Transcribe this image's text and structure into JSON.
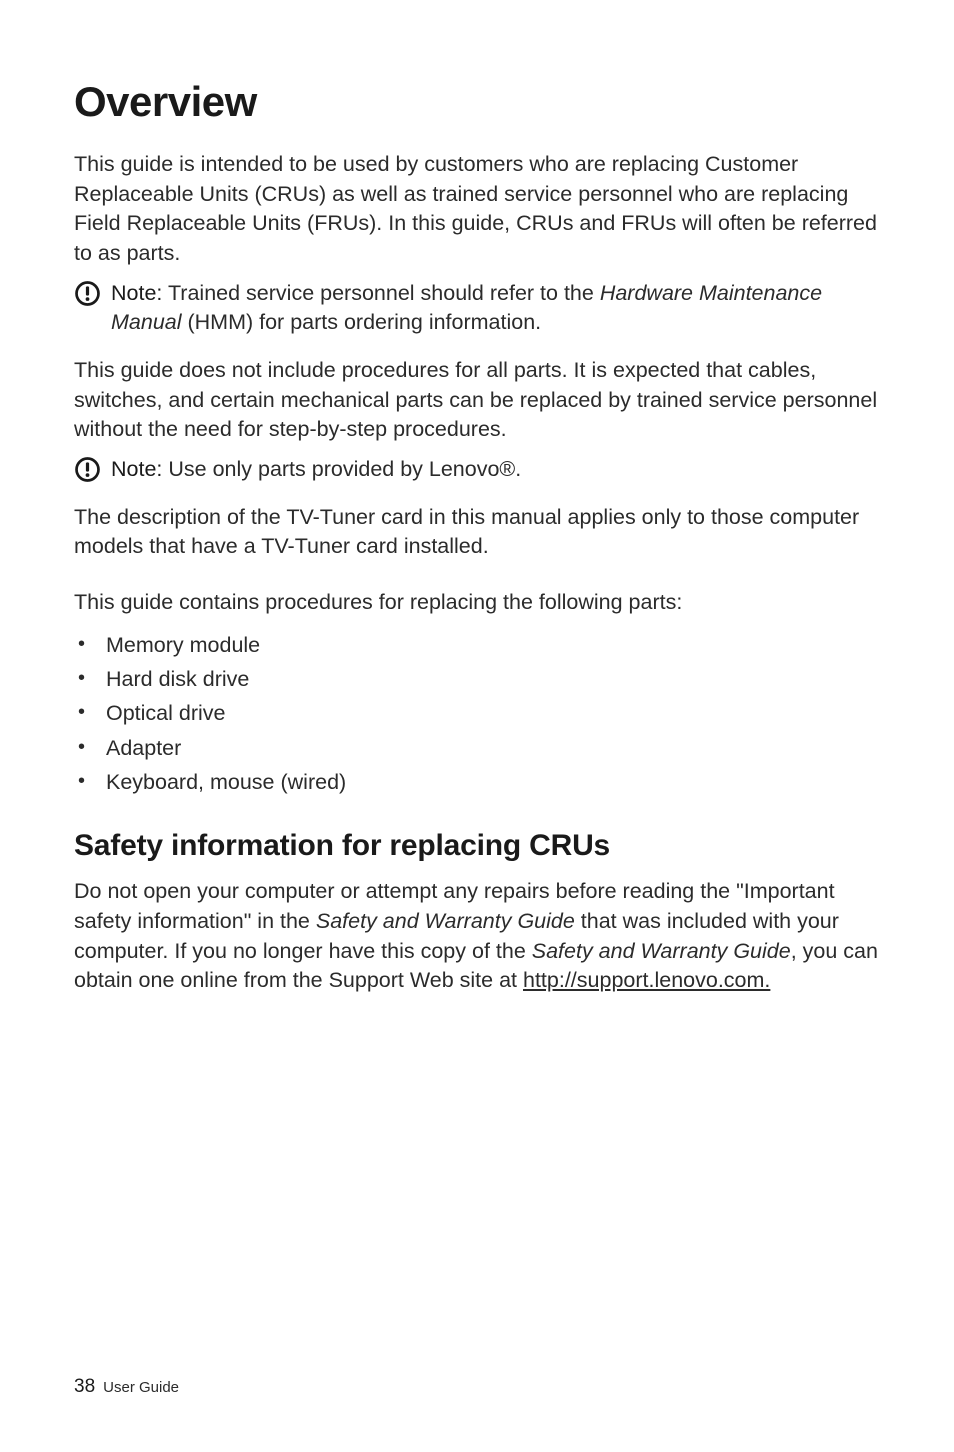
{
  "heading": "Overview",
  "intro": "This guide is intended to be used by customers who are replacing Customer Replaceable Units (CRUs) as well as trained service personnel who are replacing Field Replaceable Units (FRUs). In this guide, CRUs and FRUs will often be referred to as parts.",
  "note1": {
    "label": "Note:",
    "before_italic": " Trained service personnel should refer to the ",
    "italic": "Hardware Maintenance Manual",
    "after_italic": " (HMM) for parts ordering information."
  },
  "para2": "This guide does not include procedures for all parts. It is expected that cables, switches, and certain mechanical parts can be replaced by trained service personnel without the need for step-by-step procedures.",
  "note2": {
    "label": "Note:",
    "text": " Use only parts provided by Lenovo®."
  },
  "para3": "The description of the TV-Tuner card in this manual applies only to those computer models that have a TV-Tuner card installed.",
  "para4": "This guide contains procedures for replacing the following parts:",
  "parts": [
    "Memory module",
    "Hard disk drive",
    "Optical drive",
    "Adapter",
    "Keyboard, mouse (wired)"
  ],
  "subheading": "Safety information for replacing CRUs",
  "safety": {
    "t1": "Do not open your computer or attempt any repairs before reading the \"Important safety information\" in the ",
    "i1": "Safety and Warranty Guide",
    "t2": " that was included with your computer. If you no longer have this copy of the ",
    "i2": "Safety and Warranty Guide",
    "t3": ", you can obtain one online from the Support Web site at ",
    "link": "http://support.lenovo.com."
  },
  "footer": {
    "page": "38",
    "label": "User Guide"
  }
}
